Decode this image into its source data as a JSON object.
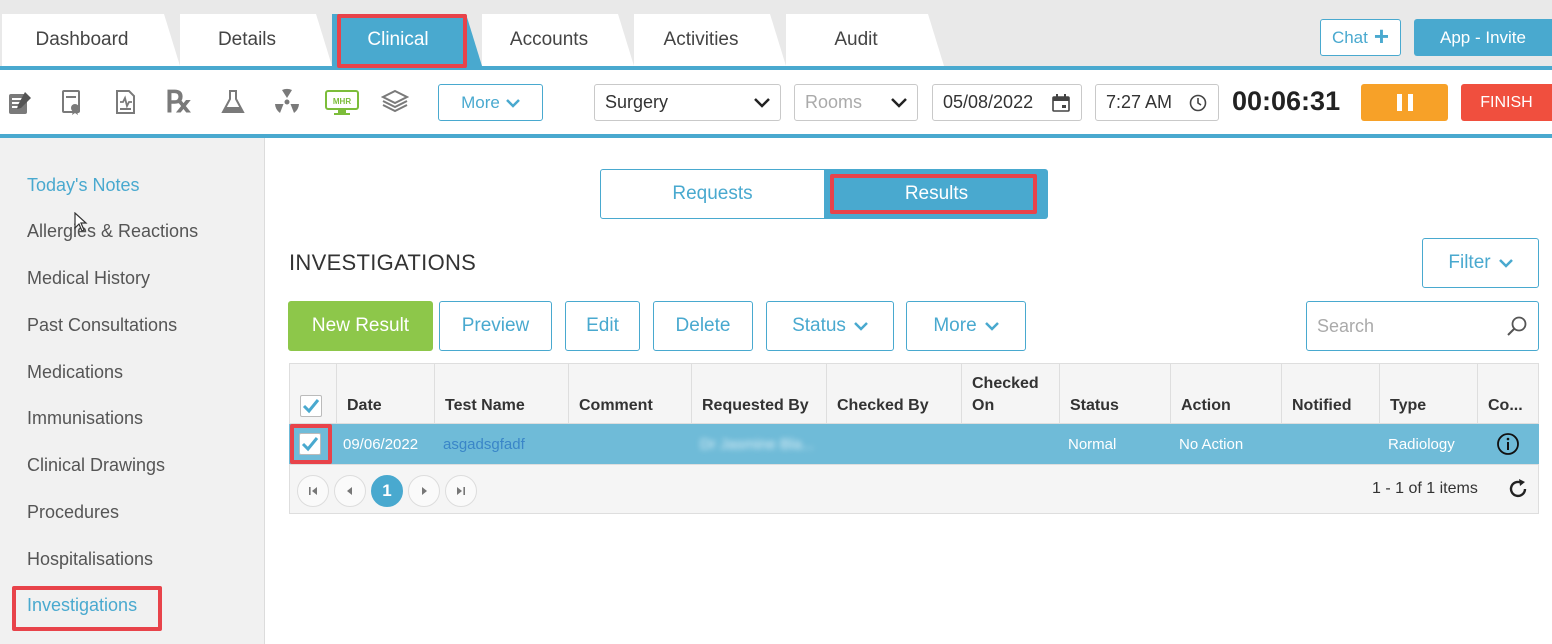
{
  "tabs": [
    {
      "label": "Dashboard",
      "active": false
    },
    {
      "label": "Details",
      "active": false
    },
    {
      "label": "Clinical",
      "active": true
    },
    {
      "label": "Accounts",
      "active": false
    },
    {
      "label": "Activities",
      "active": false
    },
    {
      "label": "Audit",
      "active": false
    }
  ],
  "header": {
    "chat_label": "Chat",
    "invite_label": "App - Invite"
  },
  "toolbar": {
    "icons": [
      "notes-icon",
      "certificate-icon",
      "document-icon",
      "rx-icon",
      "flask-icon",
      "radiation-icon",
      "mhr-icon",
      "stack-icon"
    ],
    "mhr_text": "MHR",
    "rx_text": "℞",
    "more_label": "More",
    "location": "Surgery",
    "rooms_placeholder": "Rooms",
    "date": "05/08/2022",
    "time": "7:27 AM",
    "timer": "00:06:31",
    "finish_label": "FINISH"
  },
  "sidebar": {
    "items": [
      {
        "label": "Today's Notes",
        "link": true
      },
      {
        "label": "Allergies & Reactions",
        "link": false
      },
      {
        "label": "Medical History",
        "link": false
      },
      {
        "label": "Past Consultations",
        "link": false
      },
      {
        "label": "Medications",
        "link": false
      },
      {
        "label": "Immunisations",
        "link": false
      },
      {
        "label": "Clinical Drawings",
        "link": false
      },
      {
        "label": "Procedures",
        "link": false
      },
      {
        "label": "Hospitalisations",
        "link": false
      },
      {
        "label": "Investigations",
        "link": true
      }
    ]
  },
  "main": {
    "segments": {
      "requests": "Requests",
      "results": "Results",
      "active": "results"
    },
    "heading": "INVESTIGATIONS",
    "filter_label": "Filter",
    "actions": {
      "new_result": "New Result",
      "preview": "Preview",
      "edit": "Edit",
      "delete": "Delete",
      "status": "Status",
      "more": "More"
    },
    "search_placeholder": "Search"
  },
  "grid": {
    "columns": [
      "Date",
      "Test Name",
      "Comment",
      "Requested By",
      "Checked By",
      "Checked On",
      "Status",
      "Action",
      "Notified",
      "Type",
      "Co..."
    ],
    "rows": [
      {
        "checked": true,
        "date": "09/06/2022",
        "test_name": "asgadsgfadf",
        "comment": "",
        "requested_by": "Dr Jasmine Bla...",
        "checked_by": "",
        "checked_on": "",
        "status": "Normal",
        "action": "No Action",
        "notified": "",
        "type": "Radiology"
      }
    ],
    "pager": {
      "current_page": "1",
      "info": "1 - 1 of 1 items"
    }
  },
  "colors": {
    "accent": "#49a9cf",
    "primary_green": "#8dc74a",
    "pause_orange": "#f7a128",
    "finish_red": "#f04f3e",
    "highlight_red": "#e8434a",
    "row_selected": "#6fbbd8"
  }
}
